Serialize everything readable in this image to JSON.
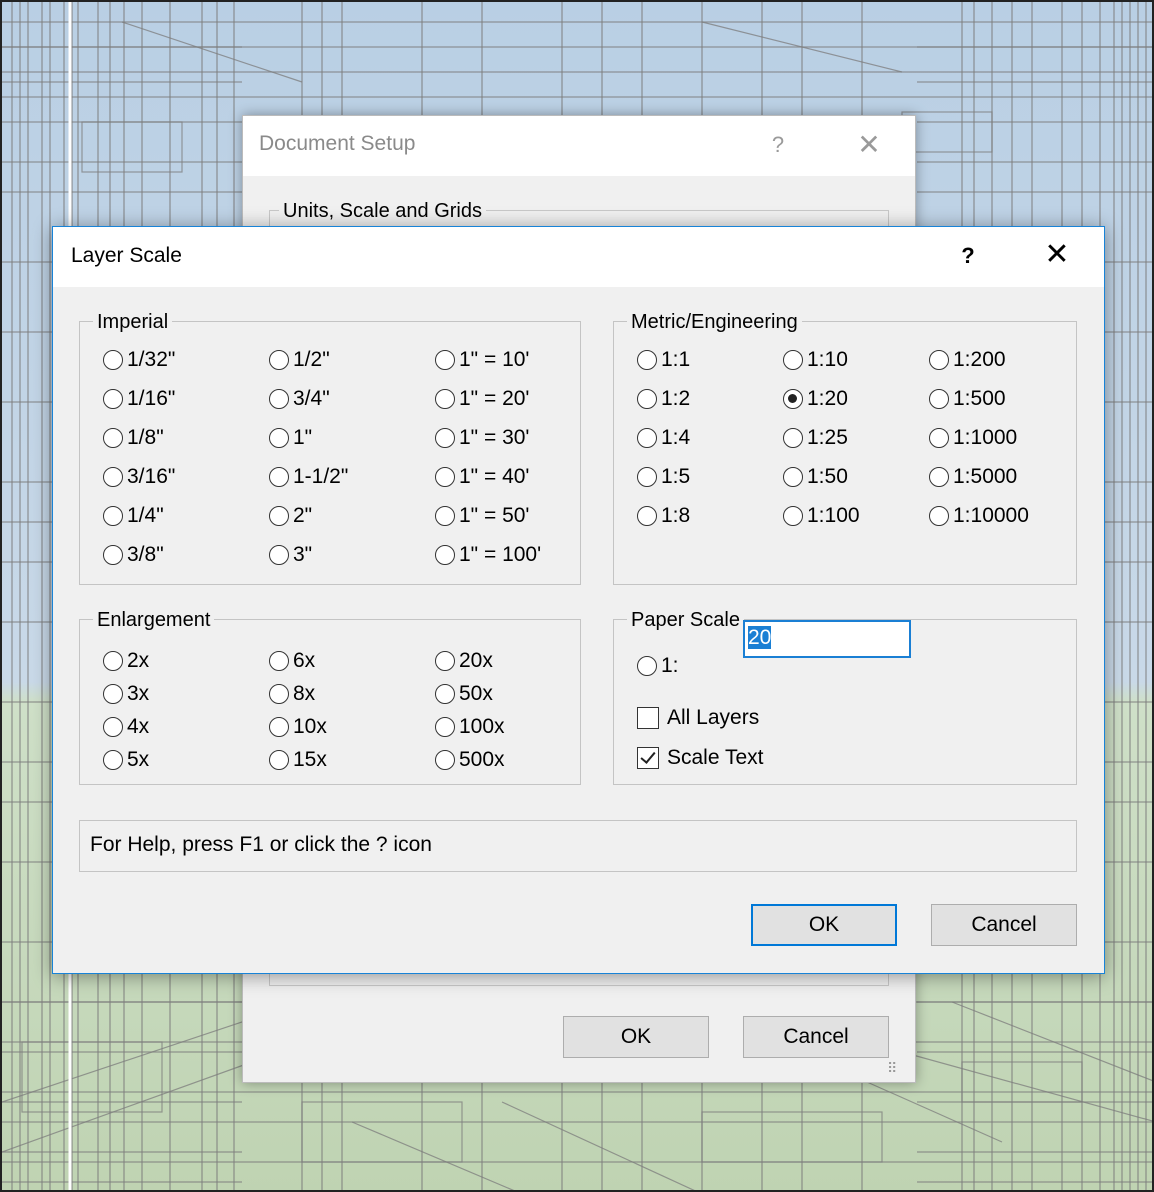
{
  "background": {
    "sky_color": "#c2d6ea",
    "ground_color": "#c4d7b6",
    "wire_color": "#7d7d7d"
  },
  "document_setup": {
    "title": "Document Setup",
    "help_icon": "?",
    "close_icon": "✕",
    "units_group_label": "Units, Scale and Grids",
    "ok_label": "OK",
    "cancel_label": "Cancel"
  },
  "layer_scale": {
    "title": "Layer Scale",
    "help_icon": "?",
    "close_icon": "✕",
    "imperial": {
      "label": "Imperial",
      "options": [
        {
          "label": "1/32\"",
          "selected": false
        },
        {
          "label": "1/16\"",
          "selected": false
        },
        {
          "label": "1/8\"",
          "selected": false
        },
        {
          "label": "3/16\"",
          "selected": false
        },
        {
          "label": "1/4\"",
          "selected": false
        },
        {
          "label": "3/8\"",
          "selected": false
        },
        {
          "label": "1/2\"",
          "selected": false
        },
        {
          "label": "3/4\"",
          "selected": false
        },
        {
          "label": "1\"",
          "selected": false
        },
        {
          "label": "1-1/2\"",
          "selected": false
        },
        {
          "label": "2\"",
          "selected": false
        },
        {
          "label": "3\"",
          "selected": false
        },
        {
          "label": "1\" = 10'",
          "selected": false
        },
        {
          "label": "1\" = 20'",
          "selected": false
        },
        {
          "label": "1\" = 30'",
          "selected": false
        },
        {
          "label": "1\" = 40'",
          "selected": false
        },
        {
          "label": "1\" = 50'",
          "selected": false
        },
        {
          "label": "1\" = 100'",
          "selected": false
        }
      ]
    },
    "metric": {
      "label": "Metric/Engineering",
      "options": [
        {
          "label": "1:1",
          "selected": false
        },
        {
          "label": "1:2",
          "selected": false
        },
        {
          "label": "1:4",
          "selected": false
        },
        {
          "label": "1:5",
          "selected": false
        },
        {
          "label": "1:8",
          "selected": false
        },
        {
          "label": "1:10",
          "selected": false
        },
        {
          "label": "1:20",
          "selected": true
        },
        {
          "label": "1:25",
          "selected": false
        },
        {
          "label": "1:50",
          "selected": false
        },
        {
          "label": "1:100",
          "selected": false
        },
        {
          "label": "1:200",
          "selected": false
        },
        {
          "label": "1:500",
          "selected": false
        },
        {
          "label": "1:1000",
          "selected": false
        },
        {
          "label": "1:5000",
          "selected": false
        },
        {
          "label": "1:10000",
          "selected": false
        }
      ]
    },
    "enlargement": {
      "label": "Enlargement",
      "options": [
        {
          "label": "2x",
          "selected": false
        },
        {
          "label": "3x",
          "selected": false
        },
        {
          "label": "4x",
          "selected": false
        },
        {
          "label": "5x",
          "selected": false
        },
        {
          "label": "6x",
          "selected": false
        },
        {
          "label": "8x",
          "selected": false
        },
        {
          "label": "10x",
          "selected": false
        },
        {
          "label": "15x",
          "selected": false
        },
        {
          "label": "20x",
          "selected": false
        },
        {
          "label": "50x",
          "selected": false
        },
        {
          "label": "100x",
          "selected": false
        },
        {
          "label": "500x",
          "selected": false
        }
      ]
    },
    "paper_scale": {
      "label": "Paper Scale",
      "radio_label": "1:",
      "radio_selected": false,
      "value": "20",
      "all_layers_label": "All Layers",
      "all_layers_checked": false,
      "scale_text_label": "Scale Text",
      "scale_text_checked": true
    },
    "help_text": "For Help, press F1 or click the ? icon",
    "ok_label": "OK",
    "cancel_label": "Cancel"
  }
}
